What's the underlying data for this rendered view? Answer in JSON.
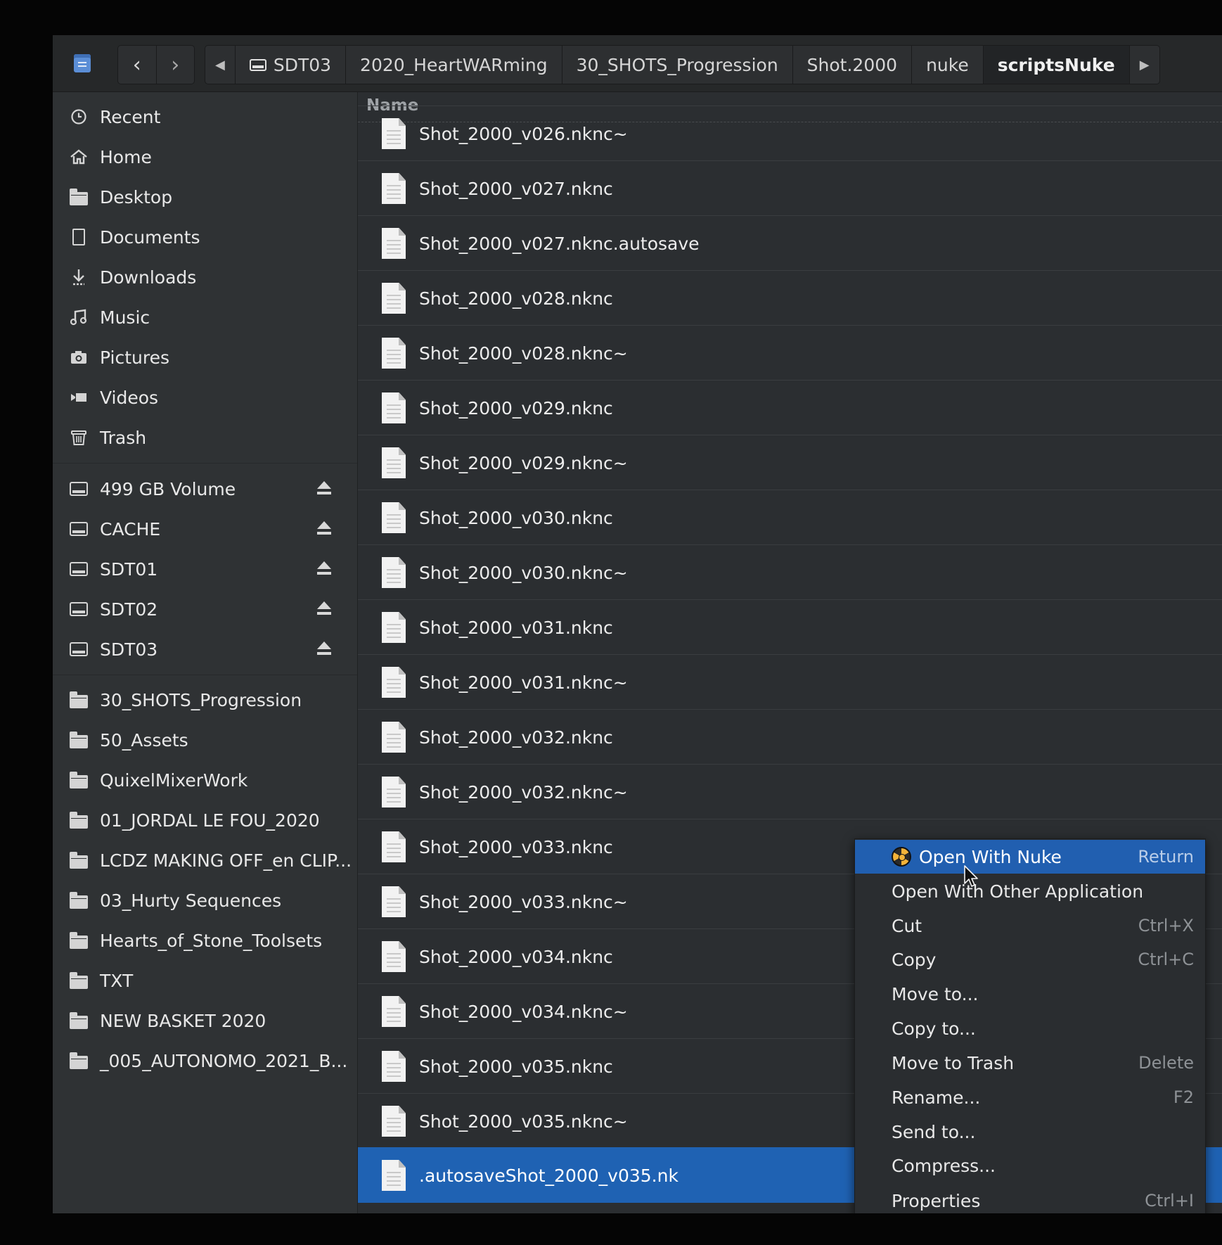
{
  "breadcrumbs": [
    {
      "label": "SDT03",
      "type": "drive"
    },
    {
      "label": "2020_HeartWARming"
    },
    {
      "label": "30_SHOTS_Progression"
    },
    {
      "label": "Shot.2000"
    },
    {
      "label": "nuke"
    },
    {
      "label": "scriptsNuke",
      "current": true
    }
  ],
  "sidebar": {
    "places": [
      {
        "label": "Recent",
        "icon": "clock-icon"
      },
      {
        "label": "Home",
        "icon": "home-icon"
      },
      {
        "label": "Desktop",
        "icon": "folder-icon"
      },
      {
        "label": "Documents",
        "icon": "document-icon"
      },
      {
        "label": "Downloads",
        "icon": "download-icon"
      },
      {
        "label": "Music",
        "icon": "music-icon"
      },
      {
        "label": "Pictures",
        "icon": "camera-icon"
      },
      {
        "label": "Videos",
        "icon": "video-icon"
      },
      {
        "label": "Trash",
        "icon": "trash-icon"
      }
    ],
    "devices": [
      {
        "label": "499 GB Volume"
      },
      {
        "label": "CACHE"
      },
      {
        "label": "SDT01"
      },
      {
        "label": "SDT02"
      },
      {
        "label": "SDT03"
      }
    ],
    "bookmarks": [
      {
        "label": "30_SHOTS_Progression"
      },
      {
        "label": "50_Assets"
      },
      {
        "label": "QuixelMixerWork"
      },
      {
        "label": "01_JORDAL LE FOU_2020"
      },
      {
        "label": "LCDZ MAKING OFF_en CLIP..."
      },
      {
        "label": "03_Hurty Sequences"
      },
      {
        "label": "Hearts_of_Stone_Toolsets"
      },
      {
        "label": "TXT"
      },
      {
        "label": "NEW BASKET 2020"
      },
      {
        "label": "_005_AUTONOMO_2021_B..."
      }
    ]
  },
  "list": {
    "column_name": "Name",
    "files": [
      "Shot_2000_v026.nknc~",
      "Shot_2000_v027.nknc",
      "Shot_2000_v027.nknc.autosave",
      "Shot_2000_v028.nknc",
      "Shot_2000_v028.nknc~",
      "Shot_2000_v029.nknc",
      "Shot_2000_v029.nknc~",
      "Shot_2000_v030.nknc",
      "Shot_2000_v030.nknc~",
      "Shot_2000_v031.nknc",
      "Shot_2000_v031.nknc~",
      "Shot_2000_v032.nknc",
      "Shot_2000_v032.nknc~",
      "Shot_2000_v033.nknc",
      "Shot_2000_v033.nknc~",
      "Shot_2000_v034.nknc",
      "Shot_2000_v034.nknc~",
      "Shot_2000_v035.nknc",
      "Shot_2000_v035.nknc~",
      ".autosaveShot_2000_v035.nk"
    ],
    "selected_file": ".autosaveShot_2000_v035.nk"
  },
  "context_menu": {
    "items": [
      {
        "label": "Open With Nuke",
        "accel": "Return",
        "highlighted": true
      },
      {
        "label": "Open With Other Application",
        "accel": ""
      },
      {
        "label": "Cut",
        "accel": "Ctrl+X"
      },
      {
        "label": "Copy",
        "accel": "Ctrl+C"
      },
      {
        "label": "Move to...",
        "accel": ""
      },
      {
        "label": "Copy to...",
        "accel": ""
      },
      {
        "label": "Move to Trash",
        "accel": "Delete"
      },
      {
        "label": "Rename...",
        "accel": "F2"
      },
      {
        "label": "Send to...",
        "accel": ""
      },
      {
        "label": "Compress...",
        "accel": ""
      },
      {
        "label": "Properties",
        "accel": "Ctrl+I"
      }
    ]
  },
  "colors": {
    "selection": "#1f62b3",
    "menu_highlight": "#215fb0",
    "window_bg": "#2b2e31",
    "sidebar_bg": "#2f3234"
  }
}
